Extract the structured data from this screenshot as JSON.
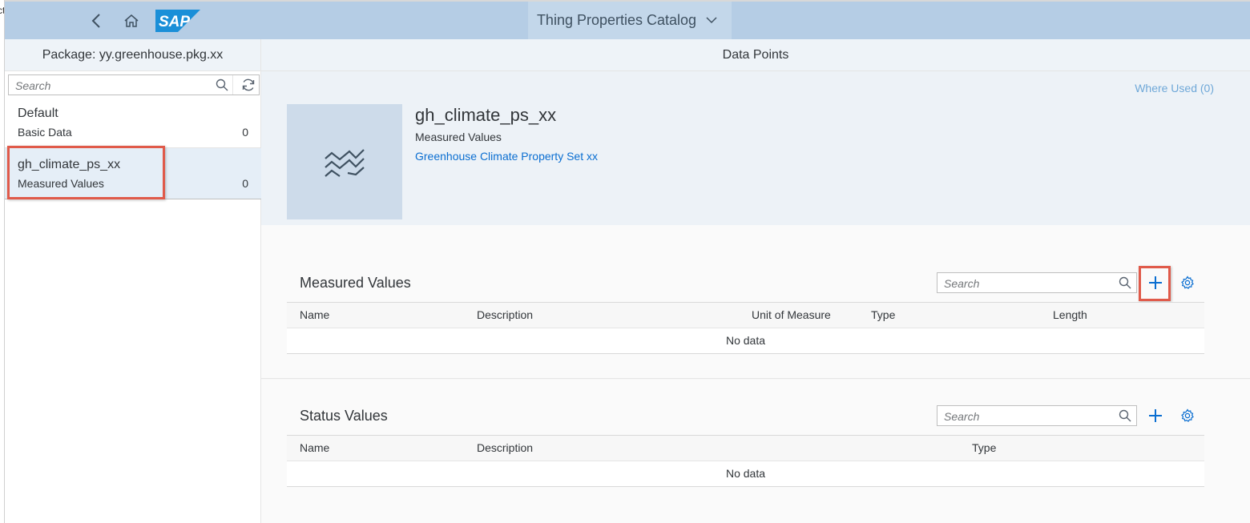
{
  "shell": {
    "title": "Thing Properties Catalog",
    "logo_text": "SAP",
    "icons": {
      "back": "chevron-left-icon",
      "home": "home-icon",
      "title_menu": "chevron-down-icon"
    }
  },
  "master": {
    "header": "Package: yy.greenhouse.pkg.xx",
    "search": {
      "placeholder": "Search"
    },
    "items": [
      {
        "title": "Default",
        "description": "Basic Data",
        "count": "0",
        "selected": false
      },
      {
        "title": "gh_climate_ps_xx",
        "description": "Measured Values",
        "count": "0",
        "selected": true
      }
    ]
  },
  "detail": {
    "header": "Data Points",
    "where_used": "Where Used (0)",
    "object": {
      "title": "gh_climate_ps_xx",
      "subtitle": "Measured Values",
      "link": "Greenhouse Climate Property Set xx",
      "icon": "measure-wave-icon"
    },
    "measured_values": {
      "title": "Measured Values",
      "search_placeholder": "Search",
      "columns": [
        "Name",
        "Description",
        "Unit of Measure",
        "Type",
        "Length"
      ],
      "rows": [],
      "no_data": "No data"
    },
    "status_values": {
      "title": "Status Values",
      "search_placeholder": "Search",
      "columns": [
        "Name",
        "Description",
        "Type"
      ],
      "rows": [],
      "no_data": "No data"
    }
  },
  "colors": {
    "shell_bg": "#b5cde5",
    "accent": "#0a6ed1",
    "annotation_red": "#e05a4a"
  },
  "edge_fragments": [
    "ct",
    "I"
  ]
}
